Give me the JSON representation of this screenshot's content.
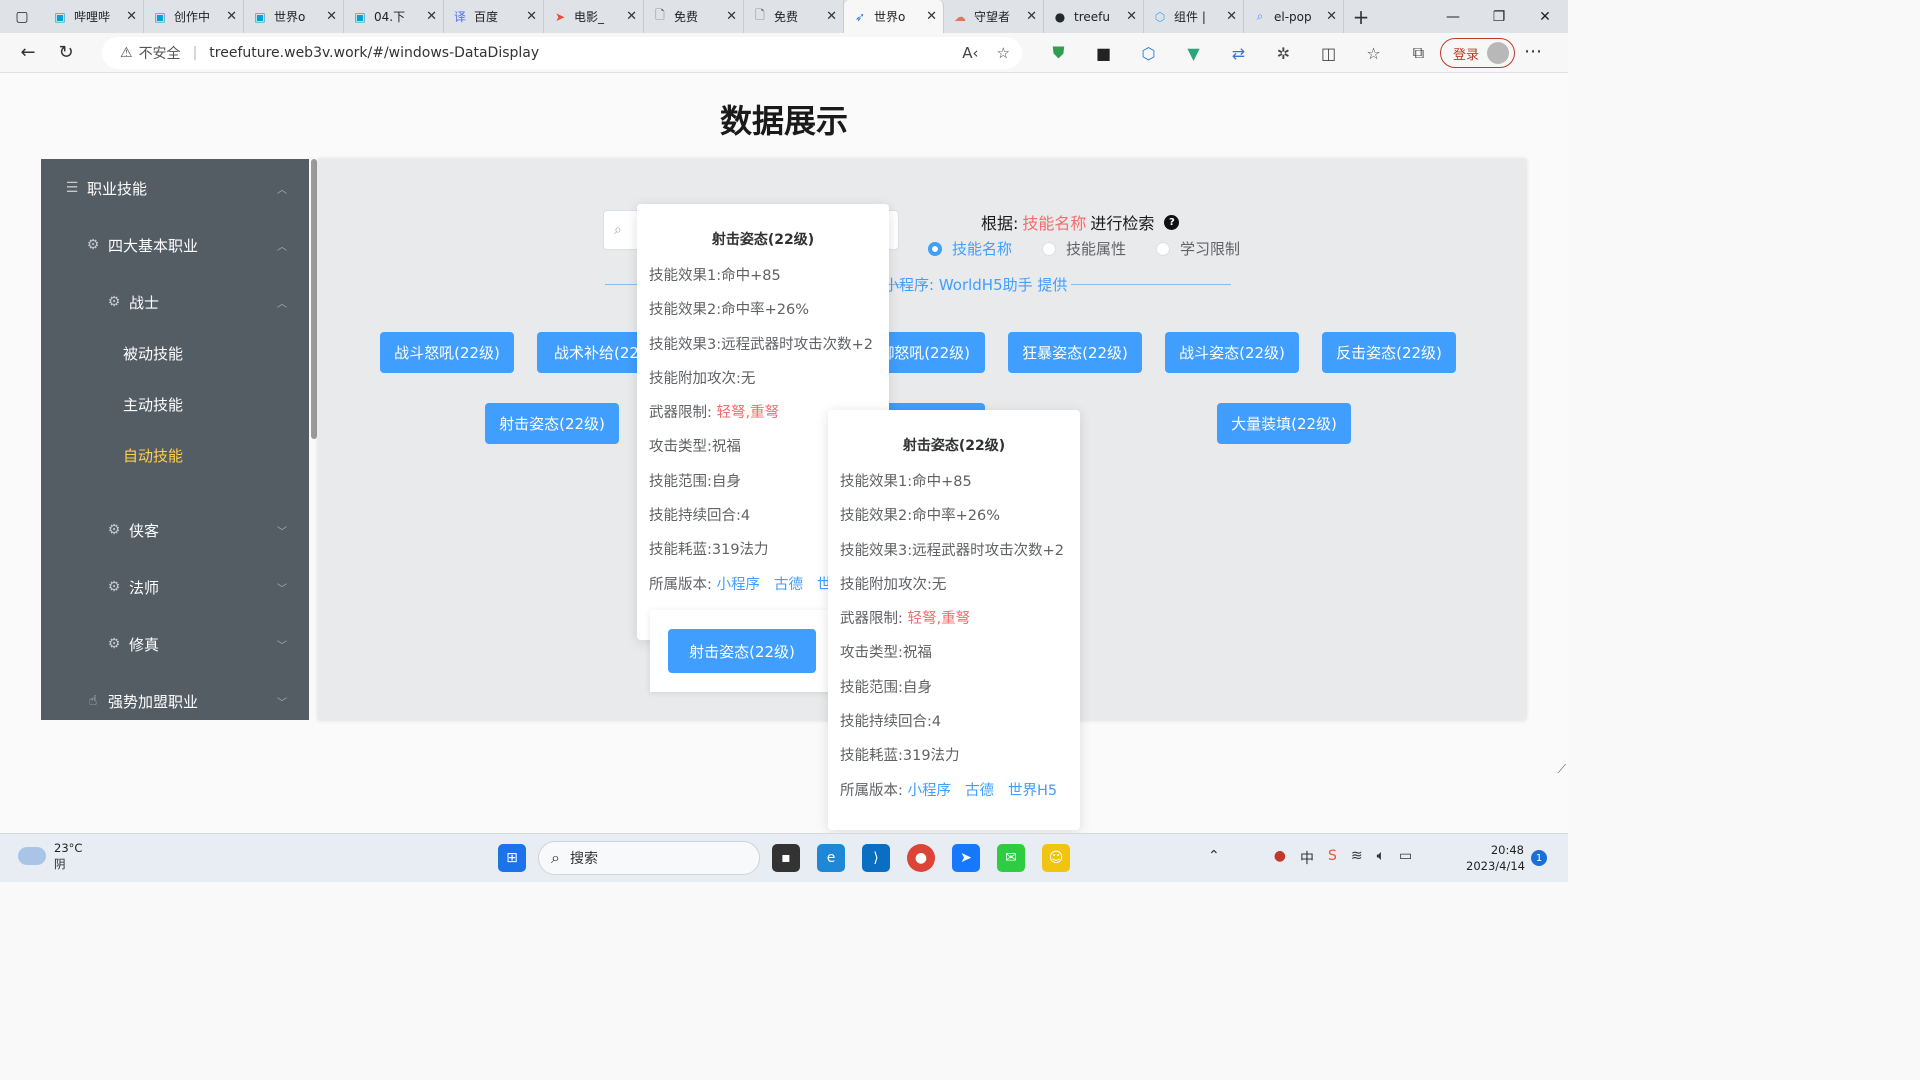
{
  "browser": {
    "tabs": [
      {
        "label": "哔哩哔",
        "icon": "bilibili-icon",
        "color": "#00a1d6",
        "glyph": "▣"
      },
      {
        "label": "创作中",
        "icon": "bilibili-icon",
        "color": "#00a1d6",
        "glyph": "▣"
      },
      {
        "label": "世界o",
        "icon": "bilibili-icon",
        "color": "#00a1d6",
        "glyph": "▣"
      },
      {
        "label": "04.下",
        "icon": "bilibili-icon",
        "color": "#00a1d6",
        "glyph": "▣"
      },
      {
        "label": "百度",
        "icon": "baidu-translate-icon",
        "color": "#4e6ef2",
        "glyph": "译"
      },
      {
        "label": "电影_",
        "icon": "movie-icon",
        "color": "#e74c3c",
        "glyph": "➤"
      },
      {
        "label": "免费",
        "icon": "document-icon",
        "color": "#555555",
        "glyph": "🗋"
      },
      {
        "label": "免费",
        "icon": "document-icon",
        "color": "#555555",
        "glyph": "🗋"
      },
      {
        "label": "世界o",
        "icon": "vue-icon",
        "color": "#2f7bd8",
        "glyph": "➶",
        "active": true
      },
      {
        "label": "守望者",
        "icon": "cloud-icon",
        "color": "#e8735a",
        "glyph": "☁"
      },
      {
        "label": "treefu",
        "icon": "github-icon",
        "color": "#24292e",
        "glyph": "●"
      },
      {
        "label": "组件 |",
        "icon": "element-icon",
        "color": "#409eff",
        "glyph": "⬡"
      },
      {
        "label": "el-pop",
        "icon": "search-icon",
        "color": "#409eff",
        "glyph": "⌕"
      }
    ],
    "address": {
      "insecure_label": "不安全",
      "url": "treefuture.web3v.work/#/windows-DataDisplay"
    },
    "login_label": "登录"
  },
  "page": {
    "title": "数据展示",
    "sidebar": {
      "items": [
        {
          "label": "职业技能",
          "icon": "stack-icon",
          "level": 0,
          "expanded": true
        },
        {
          "label": "四大基本职业",
          "icon": "cpu-icon",
          "level": 1,
          "expanded": true
        },
        {
          "label": "战士",
          "icon": "cpu-icon",
          "level": 2,
          "expanded": true
        },
        {
          "label": "被动技能",
          "level": 3
        },
        {
          "label": "主动技能",
          "level": 3
        },
        {
          "label": "自动技能",
          "level": 3,
          "active": true
        },
        {
          "label": "侠客",
          "icon": "cpu-icon",
          "level": 2,
          "expanded": false
        },
        {
          "label": "法师",
          "icon": "cpu-icon",
          "level": 2,
          "expanded": false
        },
        {
          "label": "修真",
          "icon": "cpu-icon",
          "level": 2,
          "expanded": false
        },
        {
          "label": "强势加盟职业",
          "icon": "hand-icon",
          "level": 1,
          "expanded": false
        }
      ]
    },
    "search": {
      "placeholder": "",
      "by_prefix": "根据:",
      "by_field": "技能名称",
      "by_suffix": "进行检索",
      "options": [
        {
          "label": "技能名称",
          "checked": true
        },
        {
          "label": "技能属性",
          "checked": false
        },
        {
          "label": "学习限制",
          "checked": false
        }
      ]
    },
    "provider_text": "小程序: WorldH5助手 提供",
    "skills_row1": [
      "战斗怒吼(22级)",
      "战术补给(22级)",
      "防御怒吼(22级)",
      "狂暴姿态(22级)",
      "战斗姿态(22级)",
      "反击姿态(22级)"
    ],
    "skills_row2": [
      "射击姿态(22级)",
      "",
      "大量装填(22级)"
    ],
    "inner_button": "射击姿态(22级)",
    "popover": {
      "title": "射击姿态(22级)",
      "effect1": "技能效果1:命中+85",
      "effect2": "技能效果2:命中率+26%",
      "effect3": "技能效果3:远程武器时攻击次数+2",
      "extra_attacks": "技能附加攻次:无",
      "weapon_label": "武器限制: ",
      "weapon_value": "轻弩,重弩",
      "attack_type": "攻击类型:祝福",
      "range": "技能范围:自身",
      "duration": "技能持续回合:4",
      "mana": "技能耗蓝:319法力",
      "version_label": "所属版本: ",
      "versions": [
        "小程序",
        "古德",
        "世界H5"
      ],
      "versions_clipped": [
        "小程序",
        "古德",
        "世"
      ]
    }
  },
  "taskbar": {
    "temperature": "23°C",
    "weather": "阴",
    "search_label": "搜索",
    "time": "20:48",
    "date": "2023/4/14",
    "notifications": "1"
  },
  "colors": {
    "primary": "#409eff",
    "danger": "#f56c6c",
    "sidebar_bg": "#545c64",
    "sidebar_active": "#ffd04b"
  }
}
